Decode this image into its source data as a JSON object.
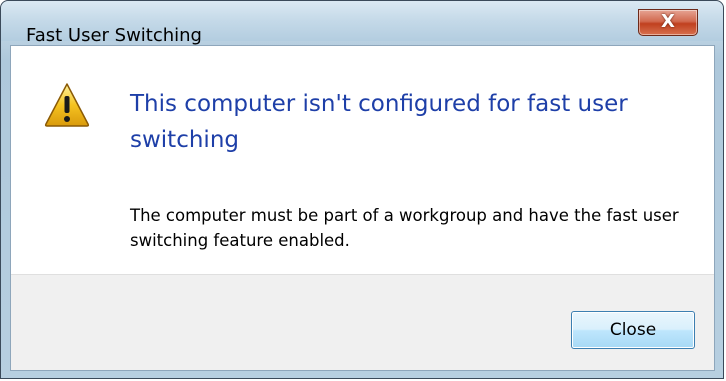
{
  "window": {
    "title": "Fast User Switching",
    "close_glyph": "X"
  },
  "message": {
    "icon": "warning-icon",
    "heading": "This computer isn't configured for fast user switching",
    "body": "The computer must be part of a workgroup and have the fast user switching feature enabled."
  },
  "buttons": {
    "close_label": "Close"
  },
  "colors": {
    "heading": "#1e3fa8",
    "warning_fill": "#f5c320",
    "close_button_red": "#c0401f"
  }
}
